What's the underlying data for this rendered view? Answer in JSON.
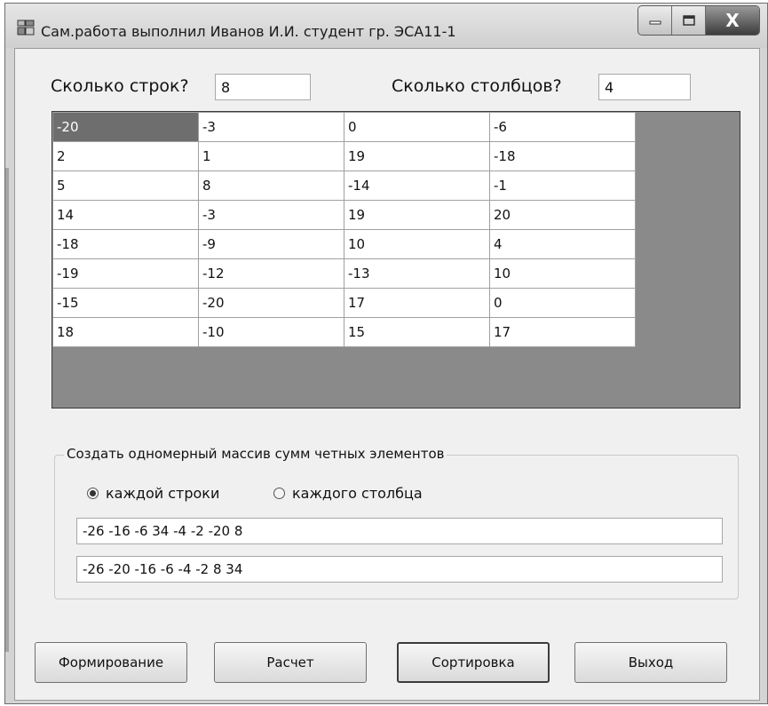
{
  "window": {
    "title": "Сам.работа выполнил Иванов И.И. студент гр. ЭСА11-1",
    "close_glyph": "X"
  },
  "inputs": {
    "rows_label": "Сколько строк?",
    "rows_value": "8",
    "cols_label": "Сколько столбцов?",
    "cols_value": "4"
  },
  "grid": {
    "rows": [
      [
        "-20",
        "-3",
        "0",
        "-6"
      ],
      [
        "2",
        "1",
        "19",
        "-18"
      ],
      [
        "5",
        "8",
        "-14",
        "-1"
      ],
      [
        "14",
        "-3",
        "19",
        "20"
      ],
      [
        "-18",
        "-9",
        "10",
        "4"
      ],
      [
        "-19",
        "-12",
        "-13",
        "10"
      ],
      [
        "-15",
        "-20",
        "17",
        "0"
      ],
      [
        "18",
        "-10",
        "15",
        "17"
      ]
    ],
    "selected_cell": [
      0,
      0
    ]
  },
  "group": {
    "title": "Создать одномерный массив сумм четных элементов",
    "radio_rows": "каждой строки",
    "radio_cols": "каждого столбца",
    "selected": "rows",
    "result": "-26 -16 -6 34 -4 -2 -20 8",
    "sorted": "-26 -20 -16 -6 -4 -2 8 34"
  },
  "buttons": {
    "form": "Формирование",
    "calc": "Расчет",
    "sort": "Сортировка",
    "exit": "Выход"
  },
  "colors": {
    "selected_cell": "#6e6e6e",
    "grid_background": "#8a8a8a"
  }
}
